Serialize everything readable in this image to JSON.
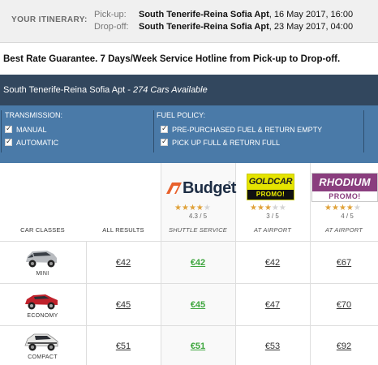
{
  "itinerary": {
    "label": "YOUR ITINERARY:",
    "pickup_key": "Pick-up:",
    "pickup_place": "South Tenerife-Reina Sofia Apt",
    "pickup_date": ", 16 May 2017, 16:00",
    "dropoff_key": "Drop-off:",
    "dropoff_place": "South Tenerife-Reina Sofia Apt",
    "dropoff_date": ", 23 May 2017, 04:00"
  },
  "guarantee": "Best Rate Guarantee. 7 Days/Week Service Hotline from Pick-up to Drop-off.",
  "location_bar": {
    "location": "South Tenerife-Reina Sofia Apt",
    "separator": " - ",
    "available": "274 Cars Available"
  },
  "filters": {
    "transmission_title": "TRANSMISSION:",
    "transmission_options": [
      "MANUAL",
      "AUTOMATIC"
    ],
    "fuel_title": "FUEL POLICY:",
    "fuel_options": [
      "PRE-PURCHASED FUEL & RETURN EMPTY",
      "PICK UP FULL & RETURN FULL"
    ]
  },
  "suppliers": [
    {
      "name": "Budget",
      "rating": 4.3,
      "rating_text": "4.3 / 5",
      "label": "SHUTTLE SERVICE",
      "logo_text": "Budget",
      "logo_tm": "®"
    },
    {
      "name": "Goldcar",
      "rating": 3,
      "rating_text": "3 / 5",
      "label": "AT AIRPORT",
      "logo_text": "GOLDCAR",
      "logo_promo": "PROMO!"
    },
    {
      "name": "Rhodium",
      "rating": 4,
      "rating_text": "4 / 5",
      "label": "AT AIRPORT",
      "logo_text": "RHODIUM",
      "logo_promo": "PROMO!"
    }
  ],
  "table": {
    "car_classes_header": "CAR CLASSES",
    "all_results_header": "ALL RESULTS",
    "rows": [
      {
        "class": "MINI",
        "all": "€42",
        "budget": "€42",
        "goldcar": "€42",
        "rhodium": "€67"
      },
      {
        "class": "ECONOMY",
        "all": "€45",
        "budget": "€45",
        "goldcar": "€47",
        "rhodium": "€70"
      },
      {
        "class": "COMPACT",
        "all": "€51",
        "budget": "€51",
        "goldcar": "€53",
        "rhodium": "€92"
      }
    ]
  },
  "colors": {
    "location_bar": "#32475e",
    "filter_panel": "#4a7aa8",
    "best_price": "#3ea63e",
    "star": "#e0a23a",
    "goldcar": "#e5e400",
    "rhodium": "#8a3e7e"
  }
}
